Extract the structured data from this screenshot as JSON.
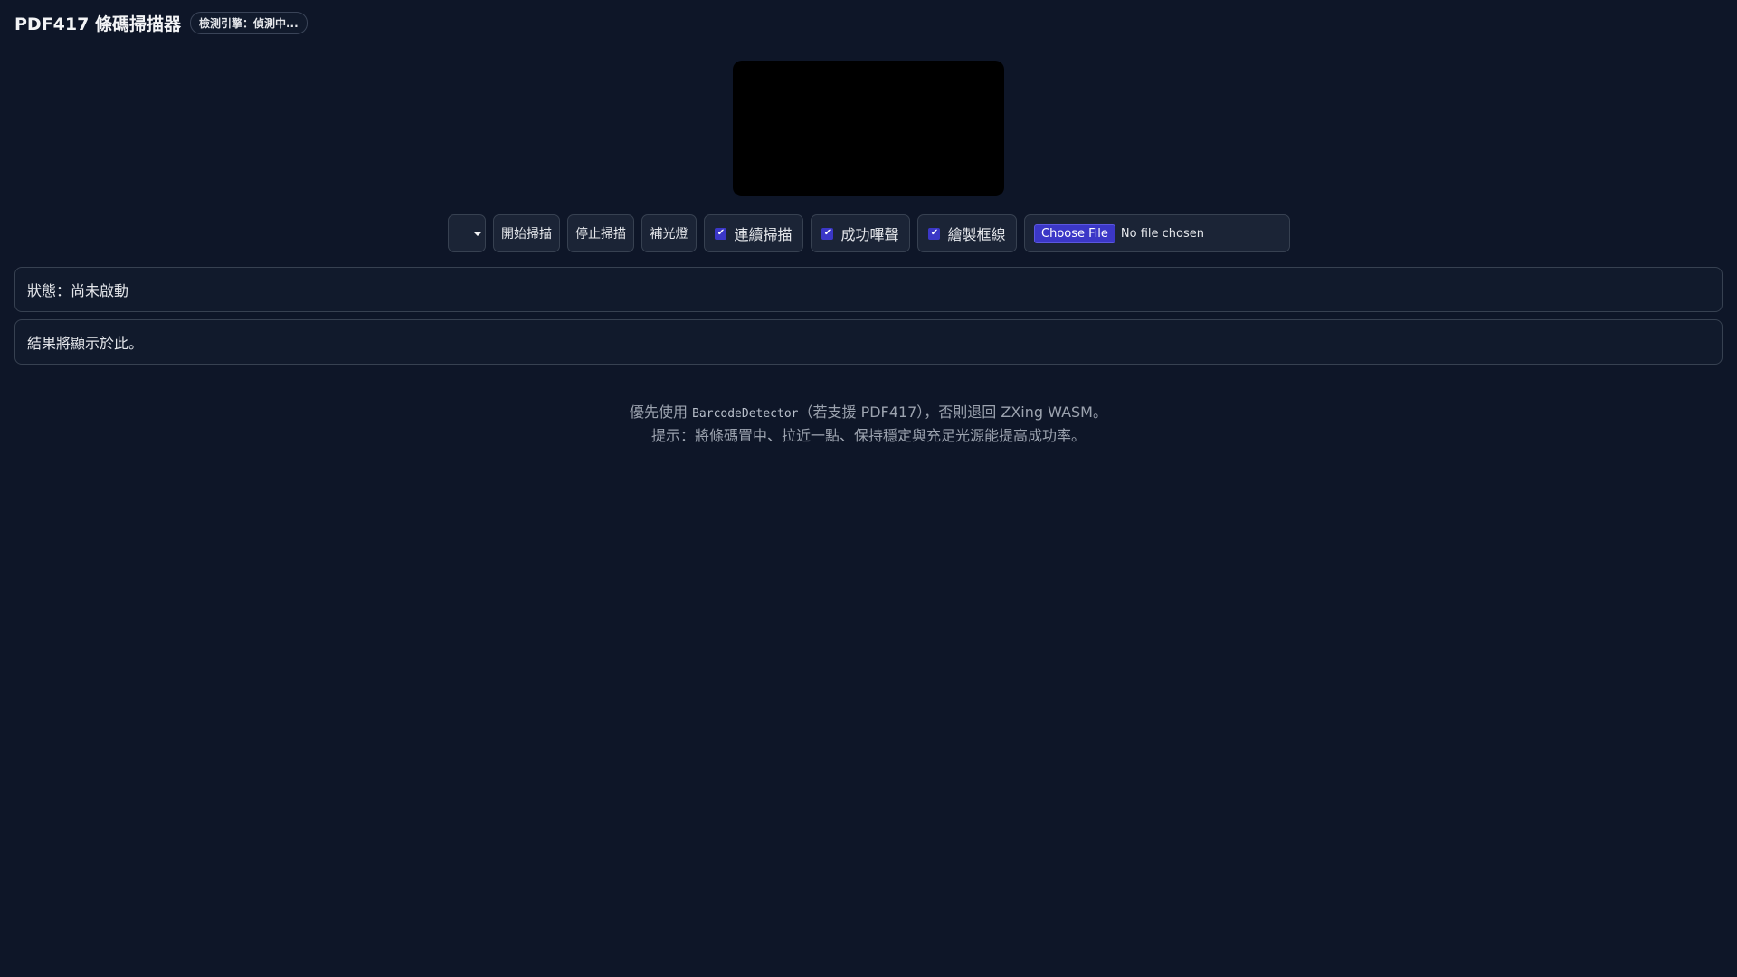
{
  "header": {
    "title": "PDF417 條碼掃描器",
    "engine_badge": "檢測引擎：偵測中..."
  },
  "controls": {
    "camera_select_value": "",
    "start_label": "開始掃描",
    "stop_label": "停止掃描",
    "torch_label": "補光燈",
    "continuous_label": "連續掃描",
    "continuous_checked": true,
    "beep_label": "成功嗶聲",
    "beep_checked": true,
    "draw_box_label": "繪製框線",
    "draw_box_checked": true,
    "choose_file_label": "Choose File",
    "no_file_text": "No file chosen"
  },
  "status": {
    "text": "狀態：尚未啟動"
  },
  "result": {
    "text": "結果將顯示於此。"
  },
  "hints": {
    "line1_prefix": "優先使用 ",
    "line1_code": "BarcodeDetector",
    "line1_suffix": "（若支援 PDF417），否則退回 ZXing WASM。",
    "line2": "提示：將條碼置中、拉近一點、保持穩定與充足光源能提高成功率。"
  },
  "colors": {
    "background": "#0e1628",
    "panel": "#111a2c",
    "control": "#1b2436",
    "accent": "#3b37c7",
    "border": "#374151",
    "muted_text": "#9ca3af"
  }
}
